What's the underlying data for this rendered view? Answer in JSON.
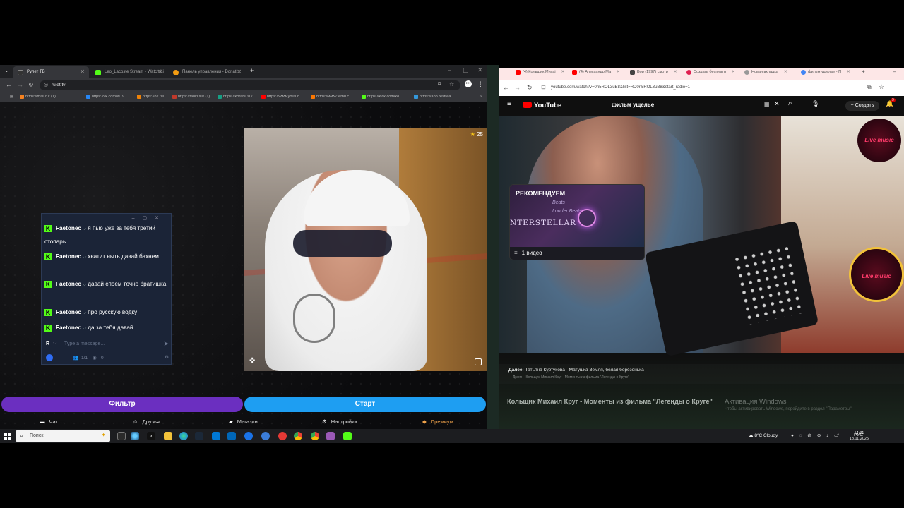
{
  "left_browser": {
    "tabs": [
      {
        "label": "Рулет ТВ",
        "active": true
      },
      {
        "label": "Leo_Lacoste Stream - Watch Li",
        "active": false
      },
      {
        "label": "Панель управления - Donati",
        "active": false
      }
    ],
    "address": "rulet.tv",
    "bookmarks": [
      "https://mail.ru/ (1)",
      "https://vk.com/id19...",
      "https://ok.ru/",
      "https://tanki.su/ (1)",
      "https://korabli.su/",
      "https://www.youtub...",
      "https://www.temu.c...",
      "https://kick.com/ko...",
      "https://app.restrea..."
    ]
  },
  "rulet": {
    "star_count": "25",
    "chat": {
      "messages": [
        {
          "user": "Faetonec",
          "text": "я пью уже за тебя третий стопарь"
        },
        {
          "user": "Faetonec",
          "text": "хватит ныть давай бахнем"
        },
        {
          "user": "Faetonec",
          "text": "давай споём точно братишка"
        },
        {
          "user": "Faetonec",
          "text": "про русскую водку"
        },
        {
          "user": "Faetonec",
          "text": "да за тебя давай"
        }
      ],
      "input_avatar": "R",
      "input_placeholder": "Type a message...",
      "footer_count": "1/1",
      "footer_views": "0"
    },
    "filter_button": "Фильтр",
    "start_button": "Старт",
    "nav": [
      {
        "label": "Чат",
        "icon": "chat-icon"
      },
      {
        "label": "Друзья",
        "icon": "friends-icon"
      },
      {
        "label": "Магазин",
        "icon": "shop-icon"
      },
      {
        "label": "Настройки",
        "icon": "gear-icon"
      },
      {
        "label": "Премиум",
        "icon": "premium-icon"
      }
    ]
  },
  "right_browser": {
    "tabs": [
      "(4) Кольщик Михаі",
      "(4) Александр Ма",
      "Вор (1997) смотр",
      "Создать бесплатн",
      "Новая вкладка",
      "фильм ущелье - П"
    ],
    "address": "youtube.com/watch?v=0ri5ROL3uB8&list=RD0ri5ROL3uB8&start_radio=1"
  },
  "youtube": {
    "logo": "YouTube",
    "search_query": "фильм ущелье",
    "create_label": "Создать",
    "notif_count": "9",
    "recommend": {
      "title": "РЕКОМЕНДУЕМ",
      "beats": "Beats",
      "sub": "Louder Beats",
      "art_text": "NTERSTELLAR",
      "foot": "1 видео"
    },
    "badge_text": "Live music",
    "next_label": "Далее:",
    "next_title": "Татьяна Куртукова - Матушка Земля, белая берёзонька",
    "next_sub": "Джем – Кольщик Михаил Круг - Моменты из фильма \"Легенды о Круге\"",
    "video_title": "Кольщик Михаил Круг - Моменты из фильма \"Легенды о Круге\"",
    "activation_title": "Активация Windows",
    "activation_sub": "Чтобы активировать Windows, перейдите в раздел \"Параметры\"."
  },
  "taskbar": {
    "search_placeholder": "Поиск",
    "weather": "8°C Cloudy",
    "lang": "РУС",
    "time": "14:31",
    "date": "18.11.2025"
  }
}
